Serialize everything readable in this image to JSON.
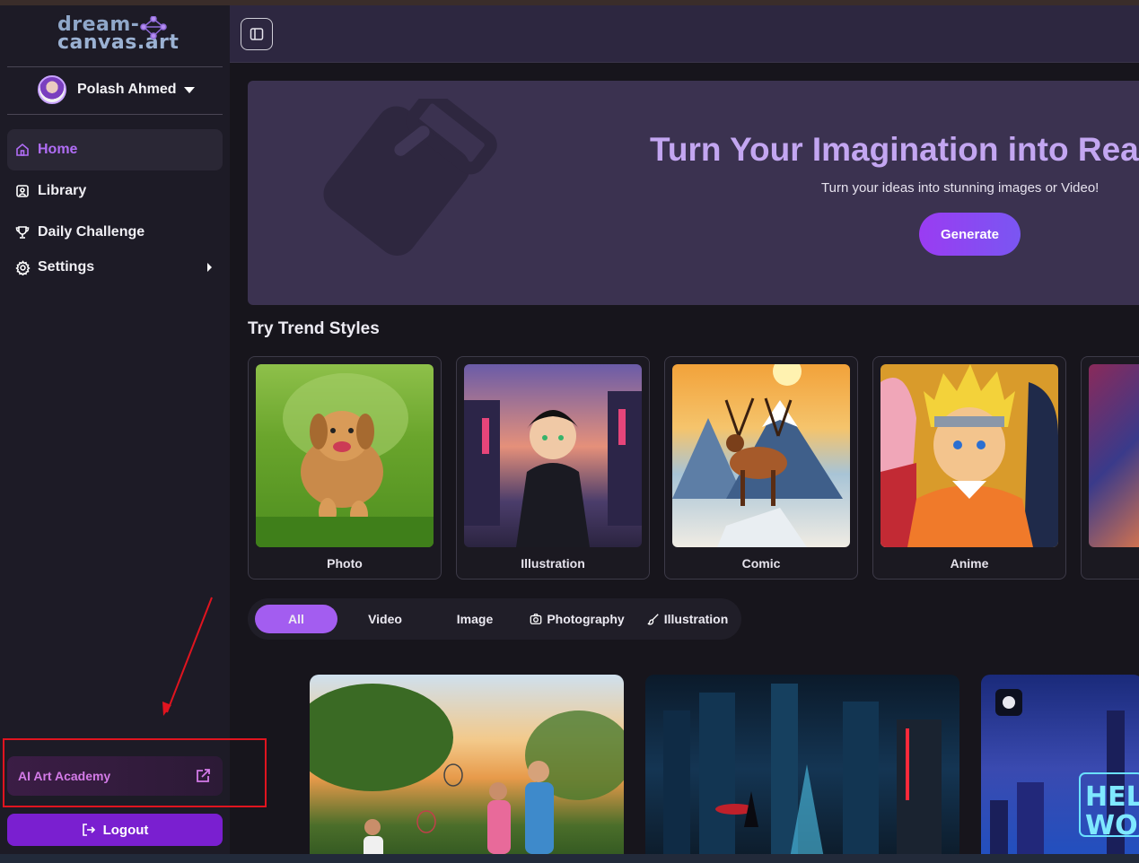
{
  "brand": {
    "line1": "dream-",
    "line2": "canvas.art"
  },
  "user": {
    "name": "Polash Ahmed"
  },
  "nav": [
    {
      "label": "Home",
      "icon": "home-icon",
      "active": true
    },
    {
      "label": "Library",
      "icon": "library-icon",
      "active": false
    },
    {
      "label": "Daily Challenge",
      "icon": "trophy-icon",
      "active": false
    },
    {
      "label": "Settings",
      "icon": "gear-icon",
      "active": false
    }
  ],
  "academy": {
    "label": "AI Art Academy",
    "icon": "external-link-icon"
  },
  "logout": {
    "label": "Logout",
    "icon": "logout-icon"
  },
  "hero": {
    "title": "Turn Your Imagination into Reali",
    "subtitle": "Turn your ideas into stunning images or Video!",
    "button": "Generate"
  },
  "trend": {
    "title": "Try Trend Styles",
    "cards": [
      {
        "label": "Photo"
      },
      {
        "label": "Illustration"
      },
      {
        "label": "Comic"
      },
      {
        "label": "Anime"
      }
    ]
  },
  "filters": [
    {
      "label": "All",
      "active": true
    },
    {
      "label": "Video",
      "active": false
    },
    {
      "label": "Image",
      "active": false
    },
    {
      "label": "Photography",
      "icon": "camera-icon",
      "active": false
    },
    {
      "label": "Illustration",
      "icon": "brush-icon",
      "active": false
    }
  ],
  "colors": {
    "accent": "#a35df0",
    "annotation": "#e0141f",
    "sidebar": "#1d1b26"
  }
}
